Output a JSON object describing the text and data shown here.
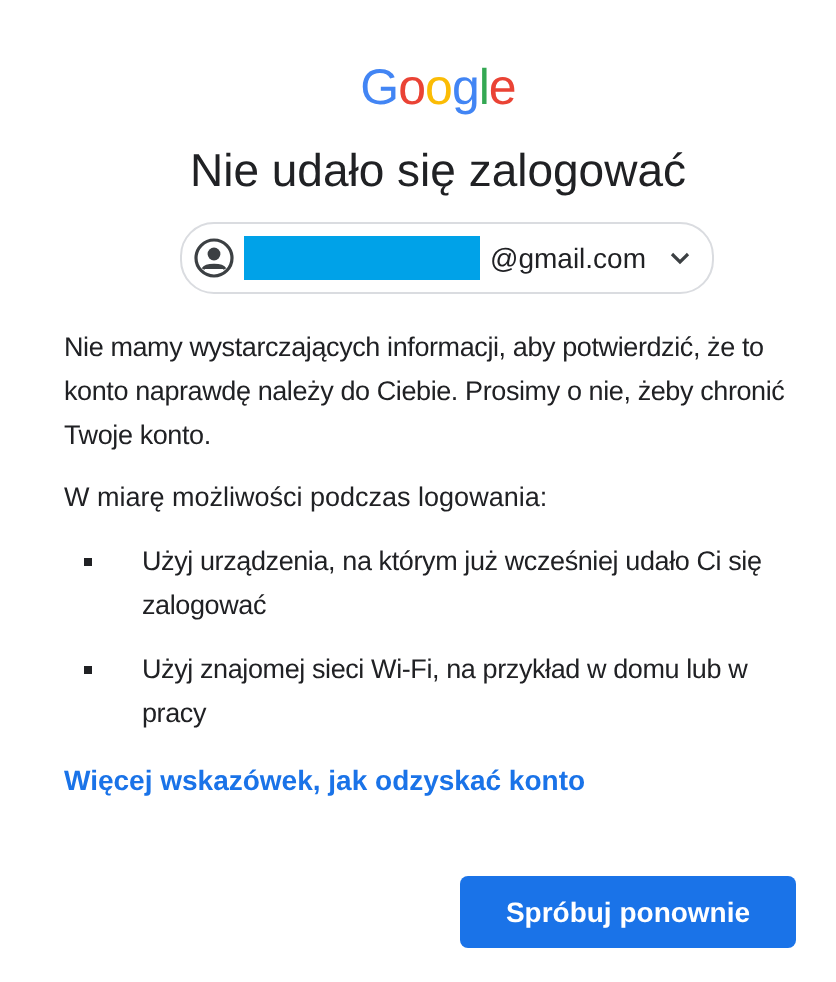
{
  "logo": {
    "letters": [
      {
        "text": "G",
        "color": "#4285f4"
      },
      {
        "text": "o",
        "color": "#ea4335"
      },
      {
        "text": "o",
        "color": "#fbbc05"
      },
      {
        "text": "g",
        "color": "#4285f4"
      },
      {
        "text": "l",
        "color": "#34a853"
      },
      {
        "text": "e",
        "color": "#ea4335"
      }
    ]
  },
  "title": "Nie udało się zalogować",
  "account": {
    "redacted": true,
    "email": "@gmail.com"
  },
  "message": "Nie mamy wystarczających informacji, aby potwierdzić, że to konto naprawdę należy do Ciebie. Prosimy o nie, żeby chronić Twoje konto.",
  "tips_intro": "W miarę możliwości podczas logowania:",
  "tips": [
    "Użyj urządzenia, na którym już wcześniej udało Ci się zalogować",
    "Użyj znajomej sieci Wi-Fi, na przykład w domu lub w pracy"
  ],
  "help_link": "Więcej wskazówek, jak odzyskać konto",
  "retry_button": "Spróbuj ponownie"
}
